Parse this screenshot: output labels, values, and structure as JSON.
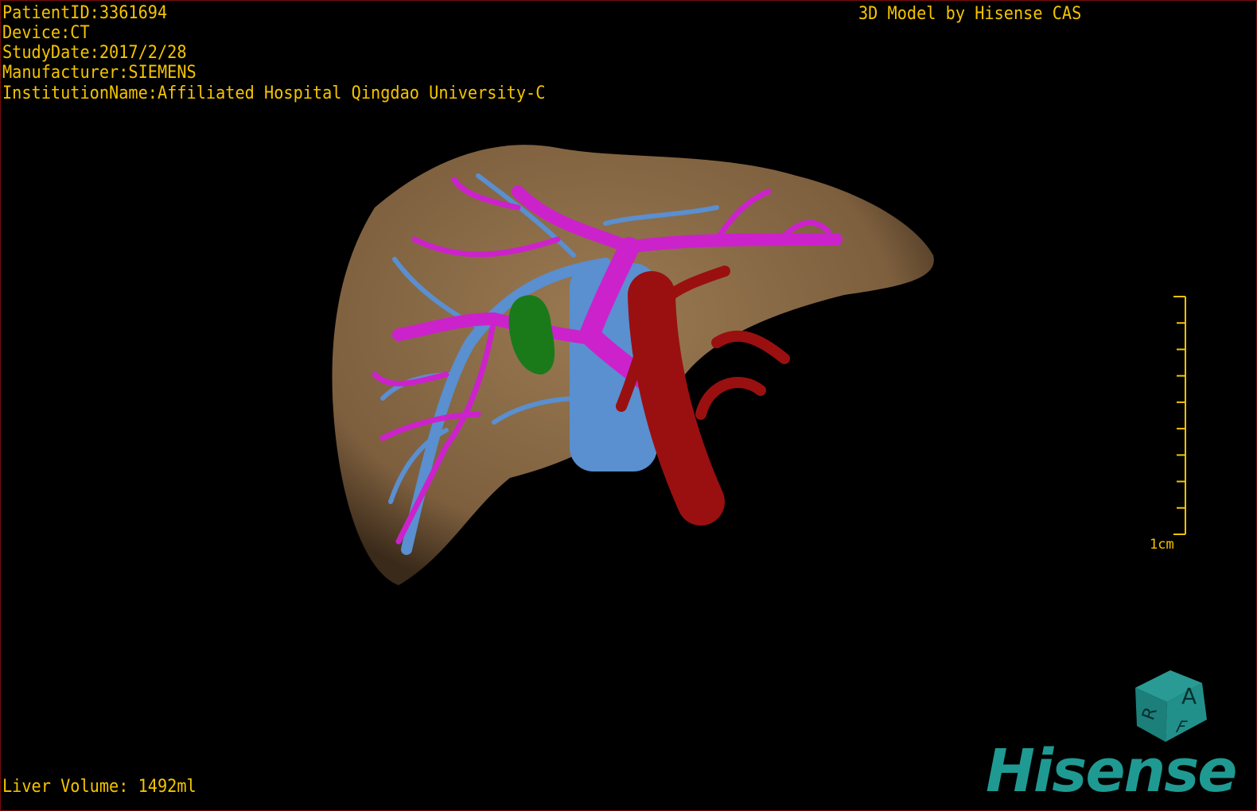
{
  "header": {
    "patient_id": "PatientID:3361694",
    "device": "Device:CT",
    "study_date": "StudyDate:2017/2/28",
    "manufacturer": "Manufacturer:SIEMENS",
    "institution": "InstitutionName:Affiliated Hospital Qingdao University-C",
    "title": "3D Model by Hisense CAS"
  },
  "footer": {
    "liver_volume": "Liver Volume: 1492ml"
  },
  "scale": {
    "label": "1cm",
    "ticks": 10
  },
  "orientation_cube": {
    "labels": [
      "A",
      "R",
      "F"
    ]
  },
  "logo": {
    "text": "Hisense"
  },
  "colors": {
    "text": "#f5c400",
    "liver": "#8a6a45",
    "portal_vein": "#cc22cc",
    "hepatic_vein": "#5a8fd0",
    "artery": "#9a1010",
    "gallbladder": "#1a7a1a",
    "logo": "#1f9a92"
  }
}
